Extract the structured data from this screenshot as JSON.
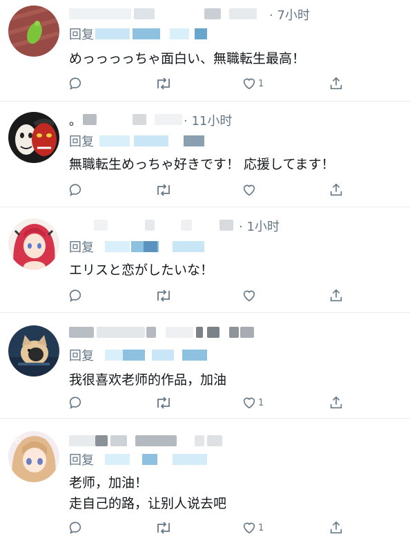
{
  "replies": [
    {
      "time": "· 7小时",
      "reply_prefix": "回复",
      "text_lines": [
        "めっっっっちゃ面白い、無職転生最高！"
      ],
      "like_count": "1",
      "avatar_desc": "frog-avatar"
    },
    {
      "time": "· 11小时",
      "reply_prefix": "回复",
      "text_lines": [
        "無職転生めっちゃ好きです！ 応援してます！"
      ],
      "like_count": "",
      "avatar_desc": "masks-avatar"
    },
    {
      "time": "· 1小时",
      "reply_prefix": "回复",
      "text_lines": [
        "エリスと恋がしたいな！"
      ],
      "like_count": "",
      "avatar_desc": "anime-girl-avatar"
    },
    {
      "time": "",
      "reply_prefix": "回复",
      "text_lines": [
        "我很喜欢老师的作品，加油"
      ],
      "like_count": "1",
      "avatar_desc": "cat-avatar"
    },
    {
      "time": "",
      "reply_prefix": "回复",
      "text_lines": [
        "老师，加油！",
        "走自己的路，让别人说去吧"
      ],
      "like_count": "1",
      "avatar_desc": "anime-girl-avatar"
    }
  ],
  "colors": {
    "muted": "#657786",
    "text": "#14171a",
    "divider": "#e6ecf0",
    "blur_light": "#c8e6f5",
    "blur_blue": "#6aa6cc",
    "blur_gray": "#9aa3ab"
  }
}
